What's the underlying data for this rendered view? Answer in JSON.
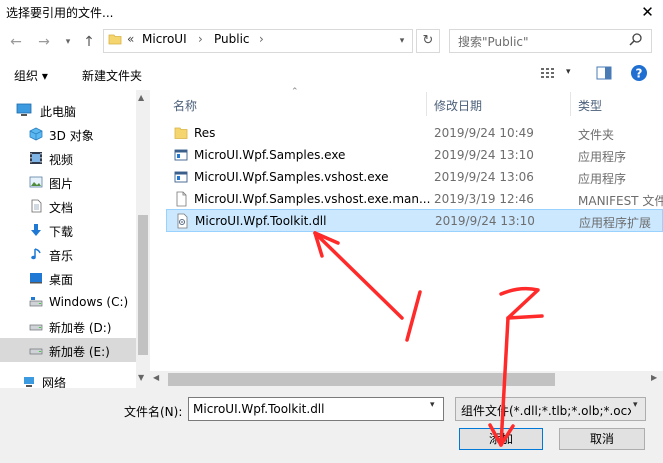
{
  "window": {
    "title": "选择要引用的文件...",
    "close": "✕"
  },
  "nav": {
    "breadcrumb": [
      "«",
      "MicroUI",
      "›",
      "Public",
      "›"
    ],
    "search_placeholder": "搜索\"Public\""
  },
  "toolbar": {
    "organize": "组织 ▾",
    "new_folder": "新建文件夹"
  },
  "sidebar": {
    "items": [
      {
        "label": "此电脑",
        "icon": "computer-icon"
      },
      {
        "label": "3D 对象",
        "icon": "cube-icon"
      },
      {
        "label": "视频",
        "icon": "video-icon"
      },
      {
        "label": "图片",
        "icon": "picture-icon"
      },
      {
        "label": "文档",
        "icon": "document-icon"
      },
      {
        "label": "下载",
        "icon": "download-icon"
      },
      {
        "label": "音乐",
        "icon": "music-icon"
      },
      {
        "label": "桌面",
        "icon": "desktop-icon"
      },
      {
        "label": "Windows (C:)",
        "icon": "drive-icon"
      },
      {
        "label": "新加卷 (D:)",
        "icon": "drive-icon"
      },
      {
        "label": "新加卷 (E:)",
        "icon": "drive-icon"
      },
      {
        "label": "网络",
        "icon": "network-icon"
      }
    ],
    "selected_index": 10
  },
  "file_list": {
    "columns": [
      "名称",
      "修改日期",
      "类型"
    ],
    "rows": [
      {
        "name": "Res",
        "date": "2019/9/24 10:49",
        "type": "文件夹",
        "icon": "folder-icon"
      },
      {
        "name": "MicroUI.Wpf.Samples.exe",
        "date": "2019/9/24 13:10",
        "type": "应用程序",
        "icon": "exe-icon"
      },
      {
        "name": "MicroUI.Wpf.Samples.vshost.exe",
        "date": "2019/9/24 13:06",
        "type": "应用程序",
        "icon": "exe-icon"
      },
      {
        "name": "MicroUI.Wpf.Samples.vshost.exe.man...",
        "date": "2019/3/19 12:46",
        "type": "MANIFEST 文件",
        "icon": "file-icon"
      },
      {
        "name": "MicroUI.Wpf.Toolkit.dll",
        "date": "2019/9/24 13:10",
        "type": "应用程序扩展",
        "icon": "dll-icon"
      }
    ],
    "selected_index": 4
  },
  "bottom": {
    "filename_label": "文件名(N):",
    "filename_value": "MicroUI.Wpf.Toolkit.dll",
    "filter_value": "组件文件(*.dll;*.tlb;*.olb;*.ocx;",
    "add_label": "添加",
    "cancel_label": "取消"
  },
  "annotations": [
    "1",
    "2"
  ],
  "colors": {
    "selection": "#cce8ff",
    "accent": "#0078d7",
    "annotation": "#ff2a2a"
  }
}
